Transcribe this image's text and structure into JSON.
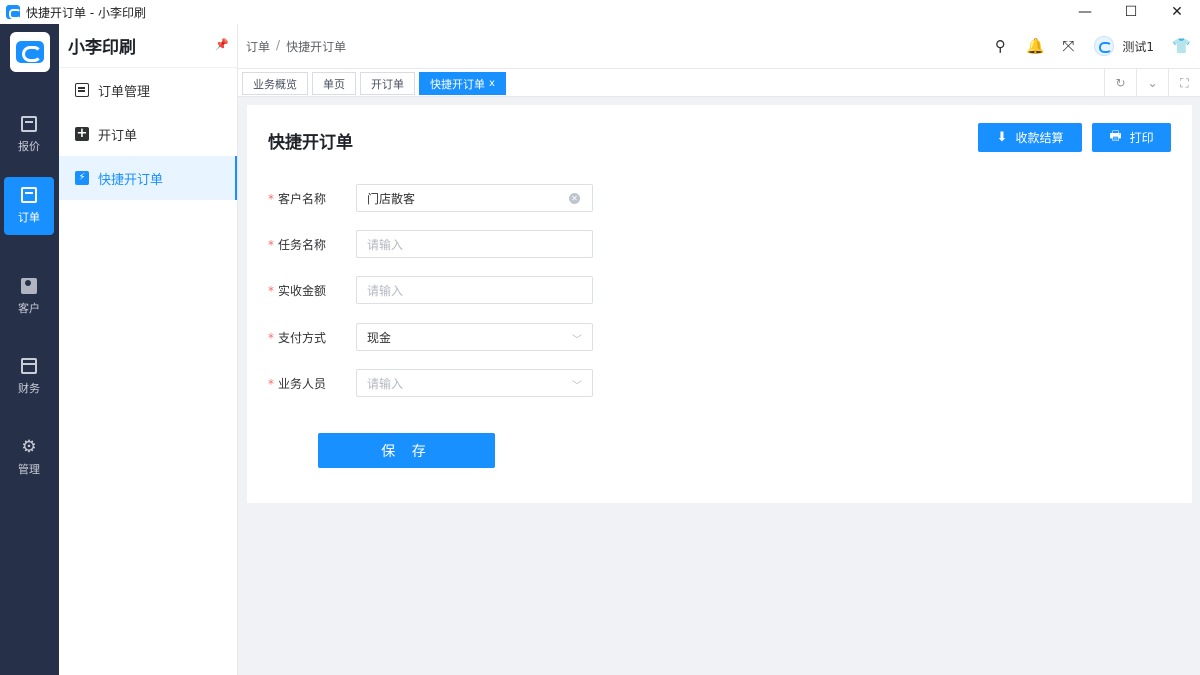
{
  "window": {
    "title": "快捷开订单 - 小李印刷",
    "controls": {
      "minimize": "—",
      "maximize": "☐",
      "close": "✕"
    }
  },
  "rail": {
    "items": [
      {
        "label": "报价",
        "icon": "calendar-icon"
      },
      {
        "label": "订单",
        "icon": "calendar-icon",
        "active": true
      },
      {
        "label": "客户",
        "icon": "user-card-icon"
      },
      {
        "label": "财务",
        "icon": "card-icon"
      },
      {
        "label": "管理",
        "icon": "gear-icon"
      }
    ]
  },
  "sidebar": {
    "brand": "小李印刷",
    "items": [
      {
        "label": "订单管理",
        "icon": "document-icon"
      },
      {
        "label": "开订单",
        "icon": "plus-square-icon"
      },
      {
        "label": "快捷开订单",
        "icon": "bolt-icon",
        "active": true
      }
    ]
  },
  "header": {
    "breadcrumb": [
      "订单",
      "快捷开订单"
    ],
    "breadcrumb_sep": "/",
    "user_name": "测试1"
  },
  "tabs": [
    {
      "label": "业务概览"
    },
    {
      "label": "单页"
    },
    {
      "label": "开订单"
    },
    {
      "label": "快捷开订单",
      "active": true,
      "close": "x"
    }
  ],
  "page": {
    "title": "快捷开订单",
    "actions": {
      "settle": "收款结算",
      "print": "打印"
    },
    "form": {
      "required_mark": "*",
      "customer": {
        "label": "客户名称",
        "value": "门店散客"
      },
      "task": {
        "label": "任务名称",
        "placeholder": "请输入"
      },
      "amount": {
        "label": "实收金额",
        "placeholder": "请输入"
      },
      "payment": {
        "label": "支付方式",
        "value": "现金"
      },
      "salesperson": {
        "label": "业务人员",
        "placeholder": "请输入"
      }
    },
    "save_label": "保 存"
  },
  "colors": {
    "primary": "#1890ff",
    "rail_bg": "#273049",
    "required": "#f56c6c"
  }
}
